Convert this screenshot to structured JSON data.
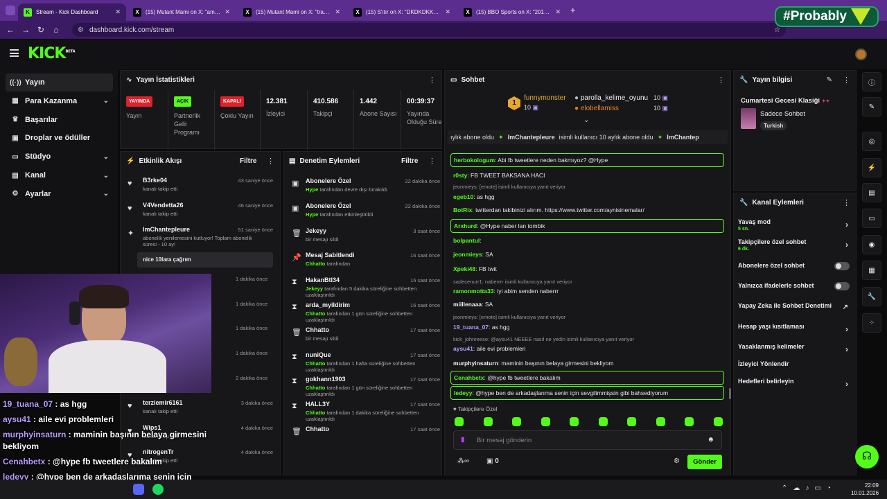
{
  "browser": {
    "tabs": [
      {
        "title": "Stream - Kick Dashboard",
        "fav": "K",
        "favcolor": "#53fc18",
        "active": true
      },
      {
        "title": "(15) Mutant Mami on X: \"amk oç",
        "fav": "X",
        "favcolor": "#000000"
      },
      {
        "title": "(15) Mutant Mami on X: \"transfe",
        "fav": "X",
        "favcolor": "#000000"
      },
      {
        "title": "(15) S'ıtır on X: \"DKDKDKKDKDK",
        "fav": "X",
        "favcolor": "#000000"
      },
      {
        "title": "(15) BBO Sports on X: \"2018 - A",
        "fav": "X",
        "favcolor": "#000000"
      }
    ],
    "new_tab": "+",
    "url": "dashboard.kick.com/stream"
  },
  "overlay_brand": "#Probably",
  "kick": {
    "logo": "KICK",
    "logo_beta": "BETA"
  },
  "sidebar": {
    "items": [
      {
        "label": "Yayın",
        "icon": "broadcast-icon",
        "glyph": "((·))"
      },
      {
        "label": "Para Kazanma",
        "icon": "money-icon",
        "glyph": "▦",
        "chev": "⌄"
      },
      {
        "label": "Başarılar",
        "icon": "trophy-icon",
        "glyph": "♛"
      },
      {
        "label": "Droplar ve ödüller",
        "icon": "gift-icon",
        "glyph": "▣"
      },
      {
        "label": "Stüdyo",
        "icon": "studio-icon",
        "glyph": "▭",
        "chev": "⌄"
      },
      {
        "label": "Kanal",
        "icon": "channel-icon",
        "glyph": "▤",
        "chev": "⌄"
      },
      {
        "label": "Ayarlar",
        "icon": "gear-icon",
        "glyph": "⚙",
        "chev": "⌄"
      }
    ]
  },
  "stats": {
    "title": "Yayın İstatistikleri",
    "items": [
      {
        "badge": "YAYINDA",
        "badgebg": "#e0202a",
        "badgefg": "#ffffff",
        "label": "Yayın"
      },
      {
        "badge": "AÇIK",
        "badgebg": "#53fc18",
        "badgefg": "#0b0b0c",
        "label": "Partnerlik Gelir Programı"
      },
      {
        "badge": "KAPALI",
        "badgebg": "#e0202a",
        "badgefg": "#ffffff",
        "label": "Çoklu Yayın"
      },
      {
        "num": "12.381",
        "label": "İzleyici"
      },
      {
        "num": "410.586",
        "label": "Takipçi"
      },
      {
        "num": "1.442",
        "label": "Abone Sayısı"
      },
      {
        "num": "00:39:37",
        "label": "Yayında Olduğu Süre"
      }
    ]
  },
  "activity": {
    "title": "Etkinlik Akışı",
    "filter": "Filtre",
    "rows": [
      {
        "name": "B3rke04",
        "sub": "kanalı takip etti",
        "time": "43 saniye önce",
        "icon": "heart-icon",
        "glyph": "♥"
      },
      {
        "name": "V4Vendetta26",
        "sub": "kanalı takip etti",
        "time": "46 saniye önce",
        "icon": "heart-icon",
        "glyph": "♥"
      },
      {
        "name": "ImChantepleure",
        "sub": "abonelik yenilemesini kutluyor! Toplam abonelik süresi - 10 ay!",
        "time": "51 saniye önce",
        "icon": "star-icon",
        "glyph": "✦"
      }
    ],
    "callout": "nice 10lara çağrım",
    "times_hidden": [
      "1 dakika önce",
      "1 dakika önce",
      "1 dakika önce",
      "1 dakika önce",
      "2 dakika önce"
    ],
    "rows2": [
      {
        "name": "terziemir6161",
        "sub": "kanalı takip etti",
        "time": "3 dakika önce",
        "icon": "heart-icon",
        "glyph": "♥"
      },
      {
        "name": "Wips1",
        "sub": "kanalı takip etti",
        "time": "4 dakika önce",
        "icon": "heart-icon",
        "glyph": "♥"
      },
      {
        "name": "nitrogenTr",
        "sub": "kanalı takip etti",
        "time": "4 dakika önce",
        "icon": "heart-icon",
        "glyph": "♥"
      }
    ]
  },
  "moderation": {
    "title": "Denetim Eylemleri",
    "filter": "Filtre",
    "rows": [
      {
        "name": "Abonelere Özel",
        "actor": "Hype",
        "sub": " tarafından devre dışı bırakıldı",
        "time": "22 dakika önce",
        "icon": "gift-icon",
        "glyph": "▣"
      },
      {
        "name": "Abonelere Özel",
        "actor": "Hype",
        "sub": " tarafından etkinleştirildi",
        "time": "22 dakika önce",
        "icon": "gift-icon",
        "glyph": "▣"
      },
      {
        "name": "Jekeyy",
        "actor": "",
        "sub": "bir mesajı sildi",
        "time": "3 saat önce",
        "icon": "trash-icon",
        "glyph": "🗑"
      },
      {
        "name": "Mesaj Sabitlendi",
        "actor": "Chhatto",
        "sub": " tarafından",
        "time": "16 saat önce",
        "icon": "pin-icon",
        "glyph": "📌"
      },
      {
        "name": "HakanBtl34",
        "actor": "Jekeyy",
        "sub": " tarafından 5 dakika süreliğine sohbetten uzaklaştırıldı",
        "time": "16 saat önce",
        "icon": "hourglass-icon",
        "glyph": "⧗"
      },
      {
        "name": "arda_myildirim",
        "actor": "Chhatto",
        "sub": " tarafından 1 gün süreliğine sohbetten uzaklaştırıldı",
        "time": "16 saat önce",
        "icon": "hourglass-icon",
        "glyph": "⧗"
      },
      {
        "name": "Chhatto",
        "actor": "",
        "sub": "bir mesajı sildi",
        "time": "17 saat önce",
        "icon": "trash-icon",
        "glyph": "🗑"
      },
      {
        "name": "nuniQue",
        "actor": "Chhatto",
        "sub": " tarafından 1 hafta süreliğine sohbetten uzaklaştırıldı",
        "time": "17 saat önce",
        "icon": "hourglass-icon",
        "glyph": "⧗"
      },
      {
        "name": "gokhann1903",
        "actor": "Chhatto",
        "sub": " tarafından 1 gün süreliğine sohbetten uzaklaştırıldı",
        "time": "17 saat önce",
        "icon": "hourglass-icon",
        "glyph": "⧗"
      },
      {
        "name": "HALL3Y",
        "actor": "Chhatto",
        "sub": " tarafından 1 dakika süreliğine sohbetten uzaklaştırıldı",
        "time": "17 saat önce",
        "icon": "hourglass-icon",
        "glyph": "⧗"
      },
      {
        "name": "Chhatto",
        "actor": "",
        "sub": "",
        "time": "17 saat önce",
        "icon": "trash-icon",
        "glyph": "🗑"
      }
    ]
  },
  "chat": {
    "title": "Sohbet",
    "leaders": [
      {
        "rank": "1",
        "name": "funnymonster",
        "count": "10"
      },
      {
        "name": "parolla_kelime_oyunu",
        "count": "10"
      },
      {
        "name": "elobellamiss",
        "count": "10"
      }
    ],
    "ticker": [
      "ıylık abone oldu",
      "ImChantepleure",
      "isimli kullanıcı 10 aylık abone oldu",
      "ImChantep"
    ],
    "messages": [
      {
        "user": "herbokologum",
        "color": "#53fc18",
        "text": ": Abi fb tweetlere neden bakmıyoz? @Hype",
        "box": true
      },
      {
        "user": "r0sty",
        "color": "#53fc18",
        "text": ": FB TWEET BAKSANA HACI"
      },
      {
        "reply": "jeonmieys: [emote] isimli kullanıcıya yanıt veriyor"
      },
      {
        "user": "egeb10",
        "color": "#53fc18",
        "text": ": as hgg"
      },
      {
        "user": "BotRix",
        "color": "#53fc18",
        "text": ": twitterdan takibinizi alırım. https://www.twitter.com/aynisinemalar/"
      },
      {
        "user": "Arxhurd",
        "color": "#53fc18",
        "text": ": @Hype naber lan tombik",
        "box": true
      },
      {
        "user": "bolpantul",
        "color": "#53fc18",
        "text": ":"
      },
      {
        "user": "jeonmieys",
        "color": "#53fc18",
        "text": ": SA"
      },
      {
        "user": "Xpeki48",
        "color": "#53fc18",
        "text": ": FB twit"
      },
      {
        "reply": "sadecenurr1: naberrrr isimli kullanıcıya yanıt veriyor"
      },
      {
        "user": "ramonmotta33",
        "color": "#53fc18",
        "text": ": iyi abim senden naberrr"
      },
      {
        "user": "miillenaaa",
        "color": "#f2f2f2",
        "text": ": SA"
      },
      {
        "reply": "jeonmieys: [emote] isimli kullanıcıya yanıt veriyor"
      },
      {
        "user": "19_tuana_07",
        "color": "#b89cff",
        "text": ": as hgg"
      },
      {
        "reply": "kick_johnreese: @aysu41 NEEEE nasıl ne yedin isimli kullanıcıya yanıt veriyor"
      },
      {
        "user": "aysu41",
        "color": "#b89cff",
        "text": ": aile evi problemleri"
      },
      {
        "user": "murphyinsaturn",
        "color": "#f2f2f2",
        "text": ": maminin başının belaya girmesini bekliyom"
      },
      {
        "user": "Cenahbetx",
        "color": "#53fc18",
        "text": ": @hype fb tweetlere bakalım",
        "box": true
      },
      {
        "user": "ledeyy",
        "color": "#53fc18",
        "text": ": @hype ben de arkadaşlarıma senin için sevgilimmişsin gibi bahsediyorum",
        "box": true
      }
    ],
    "followers_only": "Takipçilere Özel",
    "input_placeholder": "Bir mesaj gönderin",
    "points": "0",
    "send": "Gönder"
  },
  "streaminfo": {
    "title": "Yayın bilgisi",
    "stream_title": "Cumartesi Gecesi Klasiği",
    "category": "Sadece Sohbet",
    "tag": "Turkish"
  },
  "channel_actions": {
    "title": "Kanal Eylemleri",
    "items": [
      {
        "label": "Yavaş mod",
        "sub": "5 sn.",
        "type": "arrow"
      },
      {
        "label": "Takipçilere özel sohbet",
        "sub": "6 dk.",
        "type": "arrow"
      },
      {
        "label": "Abonelere özel sohbet",
        "type": "toggle"
      },
      {
        "label": "Yalnızca ifadelerle sohbet",
        "type": "toggle"
      },
      {
        "label": "Yapay Zeka ile Sohbet Denetimi",
        "type": "ext"
      },
      {
        "label": "Hesap yaşı kısıtlaması",
        "type": "arrow"
      },
      {
        "label": "Yasaklanmış kelimeler",
        "type": "arrow"
      },
      {
        "label": "İzleyici Yönlendir",
        "type": "none"
      },
      {
        "label": "Hedefleri belirleyin",
        "type": "arrow"
      }
    ]
  },
  "overlay_chat": [
    {
      "user": "19_tuana_07",
      "text": " : as hgg"
    },
    {
      "user": "aysu41",
      "text": " : aile evi problemleri"
    },
    {
      "user": "murphyinsaturn",
      "text": " : maminin başının belaya girmesini bekliyom"
    },
    {
      "user": "Cenahbetx",
      "text": " : @hype fb tweetlere bakalım"
    },
    {
      "user": "ledeyy",
      "text": " : @hype ben de arkadaşlarıma senin için sevgilimmişsingibi bahsediyorum"
    }
  ],
  "taskbar": {
    "time": "22:09",
    "date": "10.01.2026"
  }
}
